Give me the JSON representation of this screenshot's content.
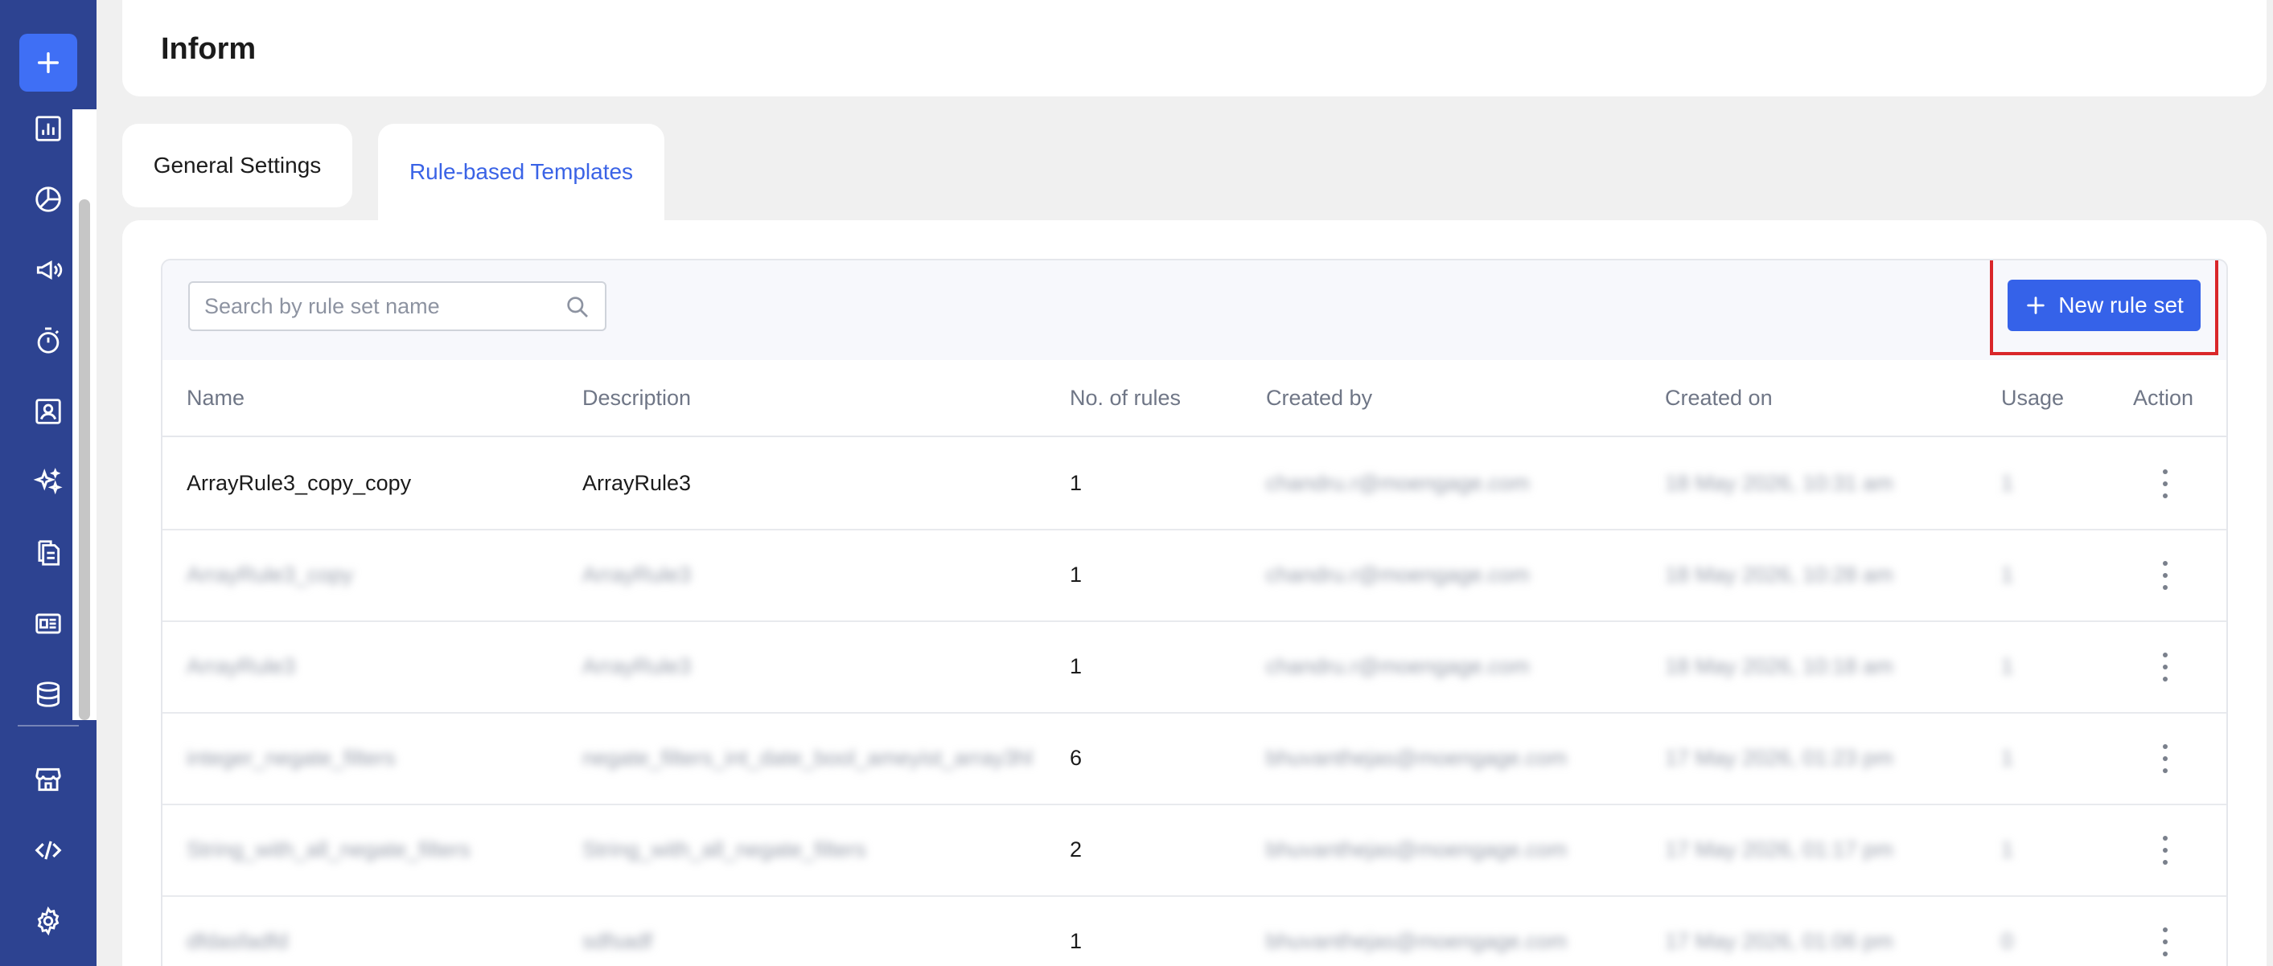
{
  "header": {
    "title": "Inform"
  },
  "tabs": [
    {
      "label": "General Settings",
      "active": false
    },
    {
      "label": "Rule-based Templates",
      "active": true
    }
  ],
  "toolbar": {
    "search_placeholder": "Search by rule set name",
    "new_button_label": "New rule set"
  },
  "table": {
    "columns": [
      "Name",
      "Description",
      "No. of rules",
      "Created by",
      "Created on",
      "Usage",
      "Action"
    ],
    "rows": [
      {
        "name": "ArrayRule3_copy_copy",
        "description": "ArrayRule3",
        "rules": "1",
        "created_by": "chandru.r@moengage.com",
        "created_on": "18 May 2026, 10:31 am",
        "usage": "1"
      },
      {
        "name": "ArrayRule3_copy",
        "description": "ArrayRule3",
        "rules": "1",
        "created_by": "chandru.r@moengage.com",
        "created_on": "18 May 2026, 10:28 am",
        "usage": "1"
      },
      {
        "name": "ArrayRule3",
        "description": "ArrayRule3",
        "rules": "1",
        "created_by": "chandru.r@moengage.com",
        "created_on": "18 May 2026, 10:18 am",
        "usage": "1"
      },
      {
        "name": "integer_negate_filters",
        "description": "negate_filters_int_date_bool_ameyist_array3hl",
        "rules": "6",
        "created_by": "bhuvanthejas@moengage.com",
        "created_on": "17 May 2026, 01:23 pm",
        "usage": "1"
      },
      {
        "name": "String_with_all_negate_filters",
        "description": "String_with_all_negate_filters",
        "rules": "2",
        "created_by": "bhuvanthejas@moengage.com",
        "created_on": "17 May 2026, 01:17 pm",
        "usage": "1"
      },
      {
        "name": "dfdasfadfd",
        "description": "sdfsadf",
        "rules": "1",
        "created_by": "bhuvanthejas@moengage.com",
        "created_on": "17 May 2026, 01:06 pm",
        "usage": "0"
      }
    ]
  },
  "colors": {
    "sidebar": "#2d4391",
    "accent": "#3562e9",
    "highlight": "#d9262a"
  }
}
